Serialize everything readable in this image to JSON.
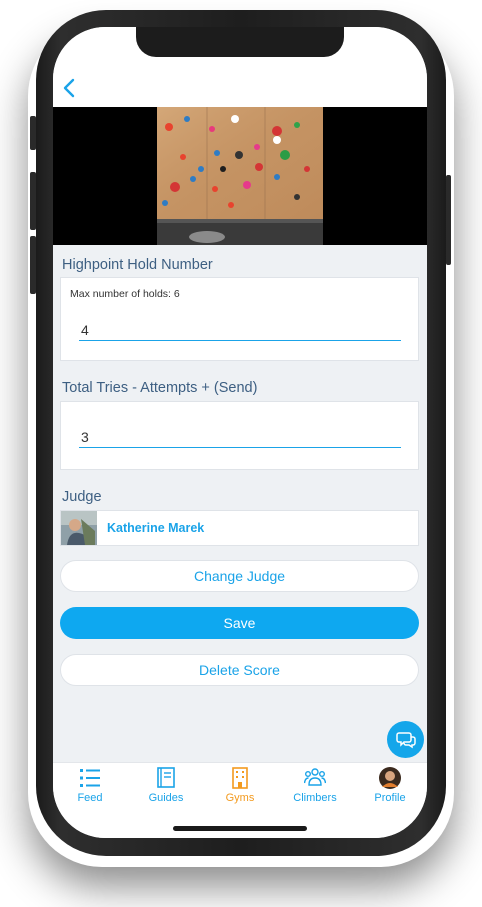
{
  "header": {
    "back_icon": "chevron-left-icon"
  },
  "highpoint": {
    "label": "Highpoint Hold Number",
    "hint": "Max number of holds: 6",
    "value": "4"
  },
  "total_tries": {
    "label": "Total Tries - Attempts + (Send)",
    "value": "3"
  },
  "judge": {
    "label": "Judge",
    "name": "Katherine Marek"
  },
  "buttons": {
    "change_judge": "Change Judge",
    "save": "Save",
    "delete_score": "Delete Score"
  },
  "tabs": [
    {
      "label": "Feed",
      "icon": "list-icon"
    },
    {
      "label": "Guides",
      "icon": "book-icon"
    },
    {
      "label": "Gyms",
      "icon": "building-icon",
      "active": true
    },
    {
      "label": "Climbers",
      "icon": "people-icon"
    },
    {
      "label": "Profile",
      "icon": "avatar-icon"
    }
  ],
  "colors": {
    "accent": "#1aa3e8",
    "active_tab": "#f39a1e",
    "save_button": "#0ea8f0",
    "label": "#3d5f82"
  }
}
